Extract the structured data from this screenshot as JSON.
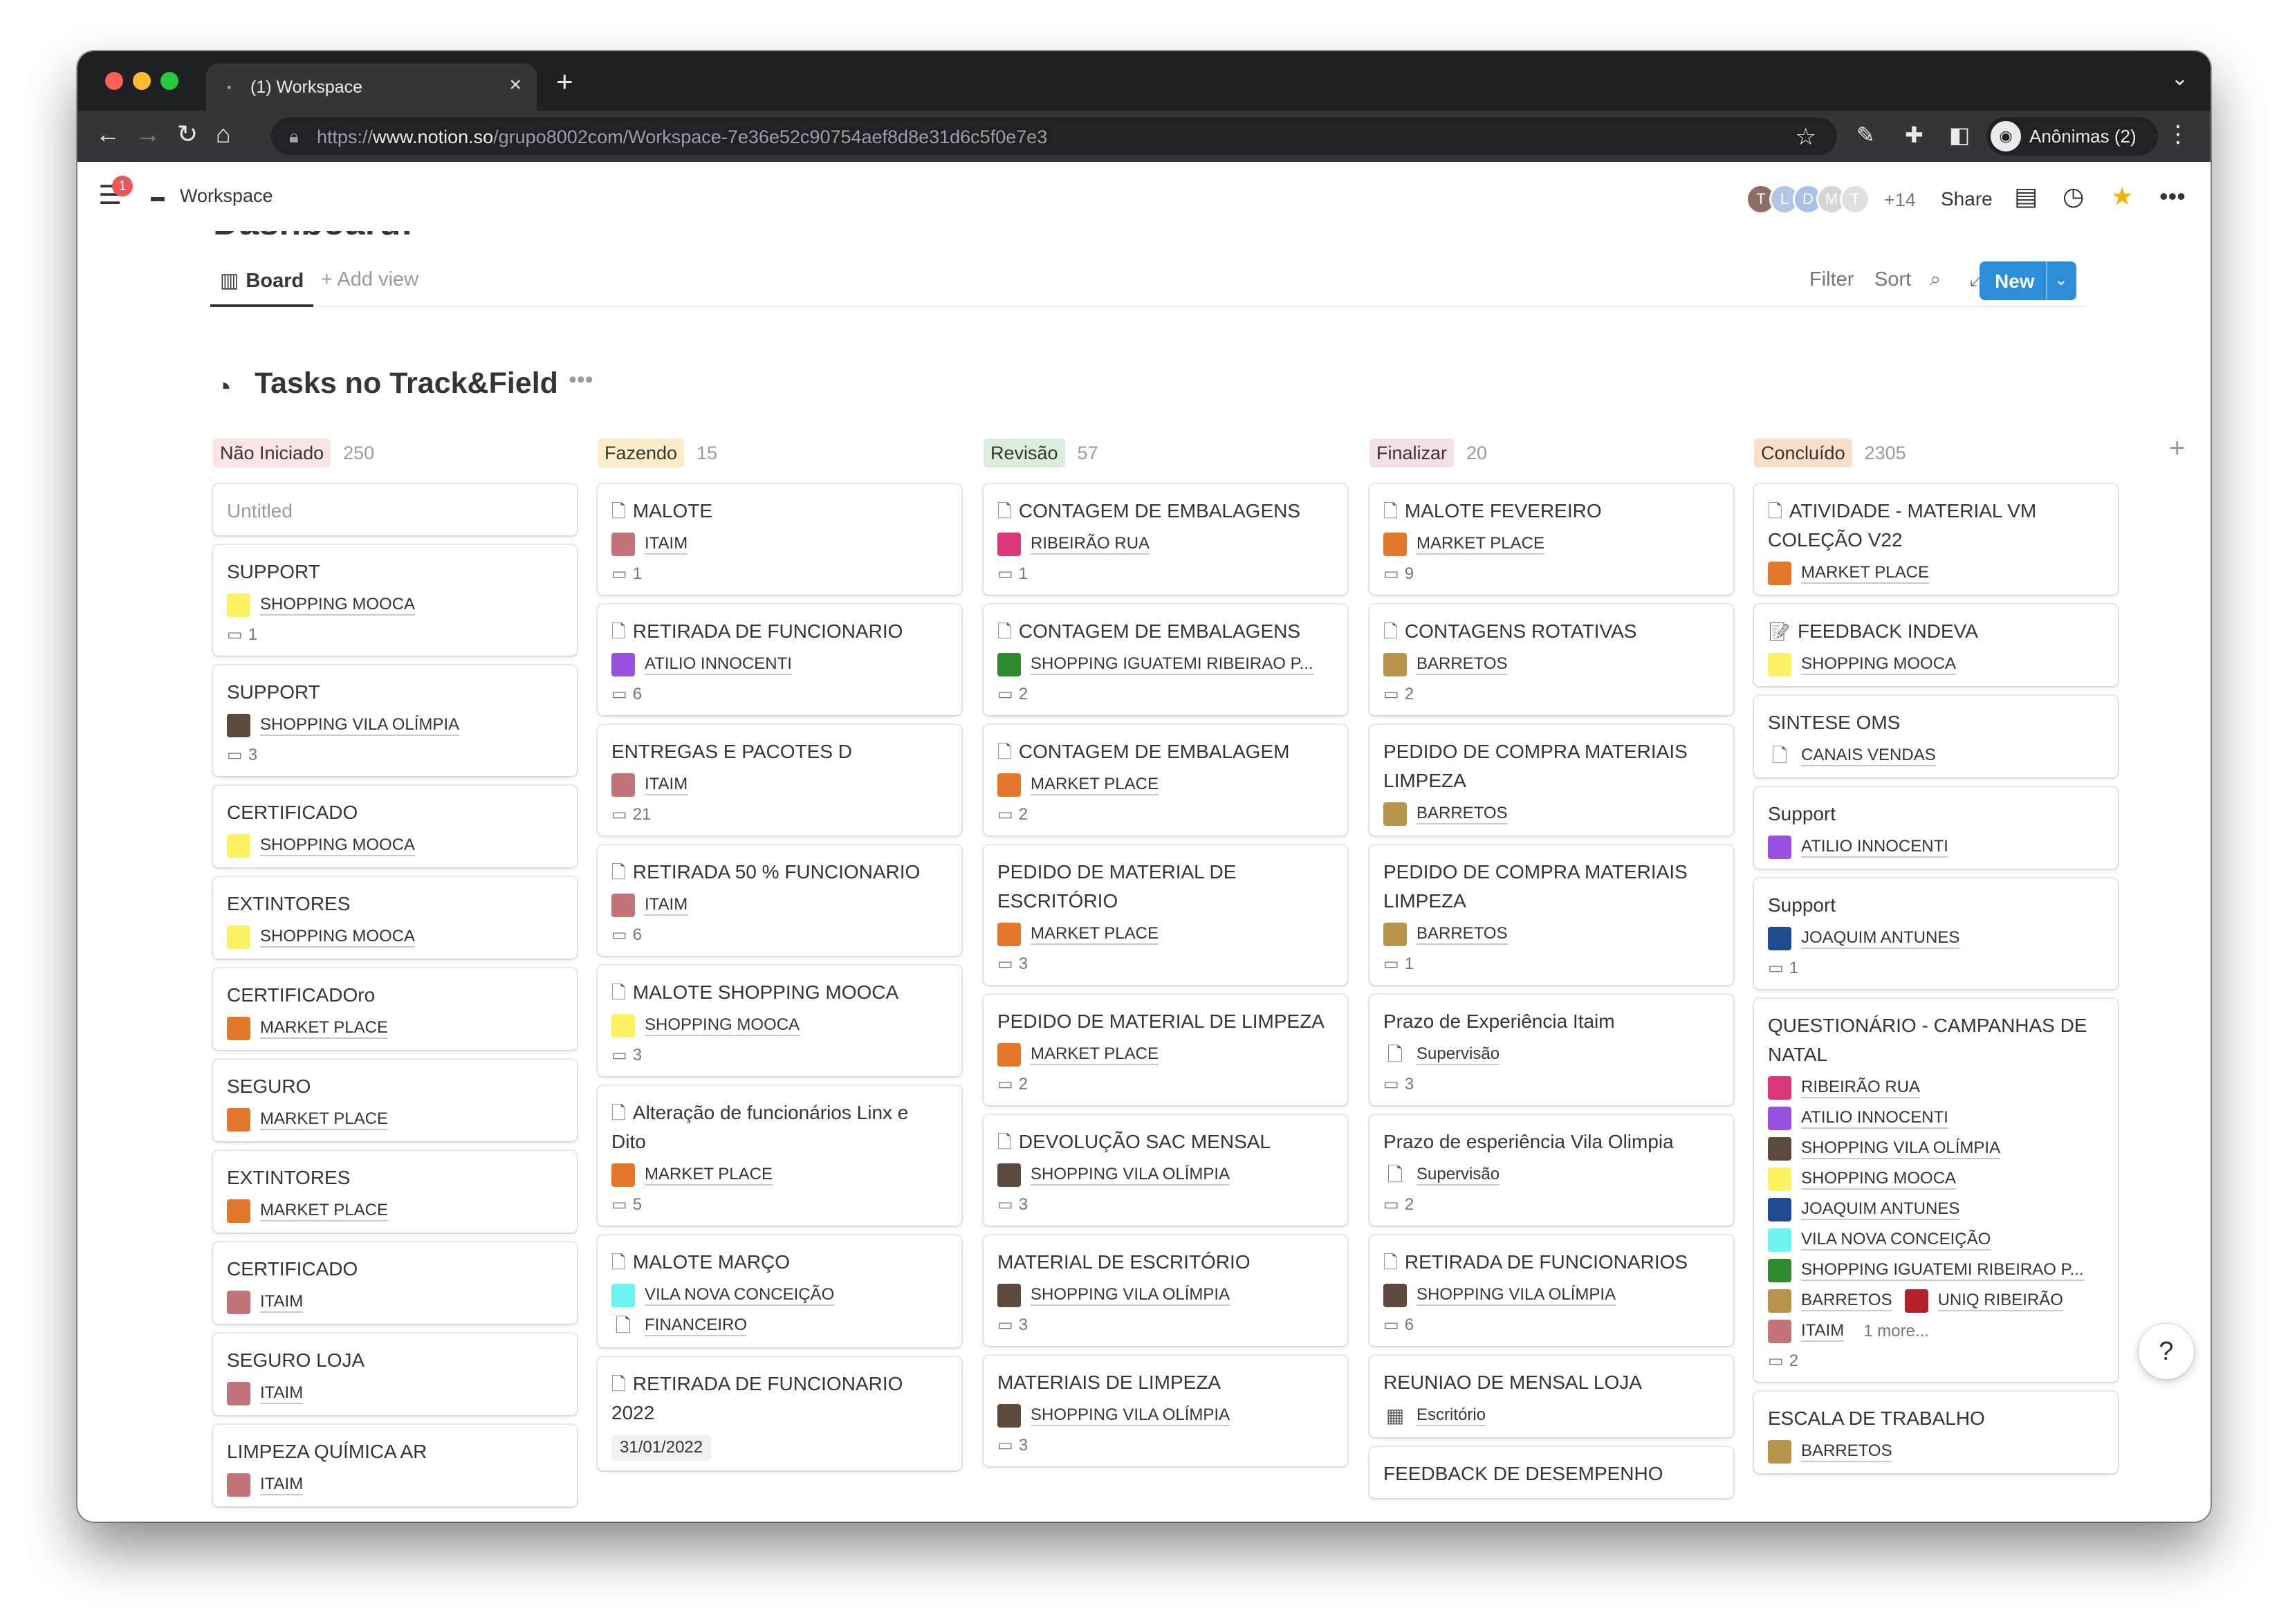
{
  "browser": {
    "tab_title": "(1) Workspace",
    "url_scheme": "https://",
    "url_host": "www.notion.so",
    "url_path": "/grupo8002com/Workspace-7e36e52c90754aef8d8e31d6c5f0e7e3",
    "profile_label": "Anônimas (2)"
  },
  "topbar": {
    "notification_count": "1",
    "workspace_title": "Workspace",
    "avatars": [
      {
        "letter": "T",
        "color": "#8d6e63"
      },
      {
        "letter": "L",
        "color": "#b3c5e6"
      },
      {
        "letter": "D",
        "color": "#a9c0e8"
      },
      {
        "letter": "M",
        "color": "#d5d5d5"
      },
      {
        "letter": "T",
        "color": "#e0e0e0"
      }
    ],
    "extra_members": "+14",
    "share_label": "Share"
  },
  "page": {
    "heading": "Dashboard:",
    "view_board_label": "Board",
    "add_view_label": "Add view",
    "filter_label": "Filter",
    "sort_label": "Sort",
    "new_label": "New",
    "db_title": "Tasks no Track&Field"
  },
  "columns": [
    {
      "name": "Não Iniciado",
      "count": "250",
      "pill_color": "#fbe4e4",
      "cards": [
        {
          "title": "Untitled",
          "untitled": true
        },
        {
          "title": "SUPPORT",
          "tags": [
            {
              "label": "SHOPPING MOOCA",
              "color": "#fdf264"
            }
          ],
          "comments": "1"
        },
        {
          "title": "SUPPORT",
          "tags": [
            {
              "label": "SHOPPING VILA OLÍMPIA",
              "color": "#5c4a3d"
            }
          ],
          "comments": "3"
        },
        {
          "title": "CERTIFICADO",
          "tags": [
            {
              "label": "SHOPPING MOOCA",
              "color": "#fdf264"
            }
          ]
        },
        {
          "title": "EXTINTORES",
          "tags": [
            {
              "label": "SHOPPING MOOCA",
              "color": "#fdf264"
            }
          ]
        },
        {
          "title": "CERTIFICADOro",
          "tags": [
            {
              "label": "MARKET PLACE",
              "color": "#e3782d"
            }
          ]
        },
        {
          "title": "SEGURO",
          "tags": [
            {
              "label": "MARKET PLACE",
              "color": "#e3782d"
            }
          ]
        },
        {
          "title": "EXTINTORES",
          "tags": [
            {
              "label": "MARKET PLACE",
              "color": "#e3782d"
            }
          ]
        },
        {
          "title": "CERTIFICADO",
          "tags": [
            {
              "label": "ITAIM",
              "color": "#c27479"
            }
          ]
        },
        {
          "title": "SEGURO LOJA",
          "tags": [
            {
              "label": "ITAIM",
              "color": "#c27479"
            }
          ]
        },
        {
          "title": "LIMPEZA QUÍMICA AR",
          "tags": [
            {
              "label": "ITAIM",
              "color": "#c27479"
            }
          ]
        }
      ]
    },
    {
      "name": "Fazendo",
      "count": "15",
      "pill_color": "#fdecc8",
      "cards": [
        {
          "title": "MALOTE",
          "doc": true,
          "tags": [
            {
              "label": "ITAIM",
              "color": "#c27479"
            }
          ],
          "comments": "1"
        },
        {
          "title": "RETIRADA DE FUNCIONARIO",
          "doc": true,
          "tags": [
            {
              "label": "ATILIO INNOCENTI",
              "color": "#9b51e0"
            }
          ],
          "comments": "6"
        },
        {
          "title": "ENTREGAS E PACOTES D",
          "tags": [
            {
              "label": "ITAIM",
              "color": "#c27479"
            }
          ],
          "comments": "21"
        },
        {
          "title": "RETIRADA 50 % FUNCIONARIO",
          "doc": true,
          "tags": [
            {
              "label": "ITAIM",
              "color": "#c27479"
            }
          ],
          "comments": "6"
        },
        {
          "title": "MALOTE SHOPPING MOOCA",
          "doc": true,
          "tags": [
            {
              "label": "SHOPPING MOOCA",
              "color": "#fdf264"
            }
          ],
          "comments": "3"
        },
        {
          "title": "Alteração de funcionários Linx e Dito",
          "doc": true,
          "tags": [
            {
              "label": "MARKET PLACE",
              "color": "#e3782d"
            }
          ],
          "comments": "5"
        },
        {
          "title": "MALOTE MARÇO",
          "doc": true,
          "tags": [
            {
              "label": "VILA NOVA CONCEIÇÃO",
              "color": "#6ff3f0"
            },
            {
              "label": "FINANCEIRO",
              "color": "doc"
            }
          ]
        },
        {
          "title": "RETIRADA DE FUNCIONARIO 2022",
          "doc": true,
          "date": "31/01/2022"
        }
      ]
    },
    {
      "name": "Revisão",
      "count": "57",
      "pill_color": "#dbeddb",
      "cards": [
        {
          "title": "CONTAGEM DE EMBALAGENS",
          "doc": true,
          "tags": [
            {
              "label": "RIBEIRÃO RUA",
              "color": "#d9377a"
            }
          ],
          "comments": "1"
        },
        {
          "title": "CONTAGEM DE EMBALAGENS",
          "doc": true,
          "tags": [
            {
              "label": "SHOPPING IGUATEMI RIBEIRAO P...",
              "color": "#2f8a2f"
            }
          ],
          "comments": "2"
        },
        {
          "title": "CONTAGEM DE EMBALAGEM",
          "doc": true,
          "tags": [
            {
              "label": "MARKET PLACE",
              "color": "#e3782d"
            }
          ],
          "comments": "2"
        },
        {
          "title": "PEDIDO DE MATERIAL DE ESCRITÓRIO",
          "tags": [
            {
              "label": "MARKET PLACE",
              "color": "#e3782d"
            }
          ],
          "comments": "3"
        },
        {
          "title": "PEDIDO DE MATERIAL DE LIMPEZA",
          "tags": [
            {
              "label": "MARKET PLACE",
              "color": "#e3782d"
            }
          ],
          "comments": "2"
        },
        {
          "title": "DEVOLUÇÃO SAC MENSAL",
          "doc": true,
          "tags": [
            {
              "label": "SHOPPING VILA OLÍMPIA",
              "color": "#5c4a3d"
            }
          ],
          "comments": "3"
        },
        {
          "title": "MATERIAL DE ESCRITÓRIO",
          "tags": [
            {
              "label": "SHOPPING VILA OLÍMPIA",
              "color": "#5c4a3d"
            }
          ],
          "comments": "3"
        },
        {
          "title": "MATERIAIS DE LIMPEZA",
          "tags": [
            {
              "label": "SHOPPING VILA OLÍMPIA",
              "color": "#5c4a3d"
            }
          ],
          "comments": "3"
        }
      ]
    },
    {
      "name": "Finalizar",
      "count": "20",
      "pill_color": "#f5e0e9",
      "cards": [
        {
          "title": "MALOTE FEVEREIRO",
          "doc": true,
          "tags": [
            {
              "label": "MARKET PLACE",
              "color": "#e3782d"
            }
          ],
          "comments": "9"
        },
        {
          "title": "CONTAGENS ROTATIVAS",
          "doc": true,
          "tags": [
            {
              "label": "BARRETOS",
              "color": "#b8944a"
            }
          ],
          "comments": "2"
        },
        {
          "title": "PEDIDO DE COMPRA MATERIAIS LIMPEZA",
          "tags": [
            {
              "label": "BARRETOS",
              "color": "#b8944a"
            }
          ]
        },
        {
          "title": "PEDIDO DE COMPRA MATERIAIS LIMPEZA",
          "tags": [
            {
              "label": "BARRETOS",
              "color": "#b8944a"
            }
          ],
          "comments": "1"
        },
        {
          "title": "Prazo de Experiência Itaim",
          "tags": [
            {
              "label": "Supervisão",
              "color": "doc"
            }
          ],
          "comments": "3"
        },
        {
          "title": "Prazo de esperiência Vila Olimpia",
          "tags": [
            {
              "label": "Supervisão",
              "color": "doc"
            }
          ],
          "comments": "2"
        },
        {
          "title": "RETIRADA DE FUNCIONARIOS",
          "doc": true,
          "tags": [
            {
              "label": "SHOPPING VILA OLÍMPIA",
              "color": "#5c4a3d"
            }
          ],
          "comments": "6"
        },
        {
          "title": "REUNIAO DE MENSAL LOJA",
          "tags": [
            {
              "label": "Escritório",
              "color": "building"
            }
          ]
        },
        {
          "title": "FEEDBACK DE DESEMPENHO"
        }
      ]
    },
    {
      "name": "Concluído",
      "count": "2305",
      "pill_color": "#fadec9",
      "cards": [
        {
          "title": "ATIVIDADE - MATERIAL VM COLEÇÃO V22",
          "doc": true,
          "tags": [
            {
              "label": "MARKET PLACE",
              "color": "#e3782d"
            }
          ]
        },
        {
          "title": "FEEDBACK INDEVA",
          "memo": true,
          "tags": [
            {
              "label": "SHOPPING MOOCA",
              "color": "#fdf264"
            }
          ]
        },
        {
          "title": "SINTESE OMS",
          "tags": [
            {
              "label": "CANAIS VENDAS",
              "color": "doc"
            }
          ]
        },
        {
          "title": "Support",
          "tags": [
            {
              "label": "ATILIO INNOCENTI",
              "color": "#9b51e0"
            }
          ]
        },
        {
          "title": "Support",
          "tags": [
            {
              "label": "JOAQUIM ANTUNES",
              "color": "#1f4a8f"
            }
          ],
          "comments": "1"
        },
        {
          "title": "QUESTIONÁRIO - CAMPANHAS DE NATAL",
          "tags": [
            {
              "label": "RIBEIRÃO RUA",
              "color": "#d9377a"
            },
            {
              "label": "ATILIO INNOCENTI",
              "color": "#9b51e0"
            },
            {
              "label": "SHOPPING VILA OLÍMPIA",
              "color": "#5c4a3d"
            },
            {
              "label": "SHOPPING MOOCA",
              "color": "#fdf264"
            },
            {
              "label": "JOAQUIM ANTUNES",
              "color": "#1f4a8f"
            },
            {
              "label": "VILA NOVA CONCEIÇÃO",
              "color": "#6ff3f0"
            },
            {
              "label": "SHOPPING IGUATEMI RIBEIRAO P...",
              "color": "#2f8a2f"
            }
          ],
          "tag_rows": [
            [
              {
                "label": "BARRETOS",
                "color": "#b8944a"
              },
              {
                "label": "UNIQ RIBEIRÃO",
                "color": "#b3212b"
              }
            ],
            [
              {
                "label": "ITAIM",
                "color": "#c27479"
              }
            ]
          ],
          "more_label": "1 more...",
          "comments": "2"
        },
        {
          "title": "ESCALA DE TRABALHO",
          "tags": [
            {
              "label": "BARRETOS",
              "color": "#b8944a"
            }
          ]
        }
      ]
    }
  ],
  "help_label": "?",
  "icons": [
    "menu-icon",
    "document-icon",
    "comment-icon",
    "search-icon",
    "expand-icon",
    "star-icon",
    "clock-icon",
    "board-icon",
    "plus-icon",
    "check-circle-icon"
  ]
}
